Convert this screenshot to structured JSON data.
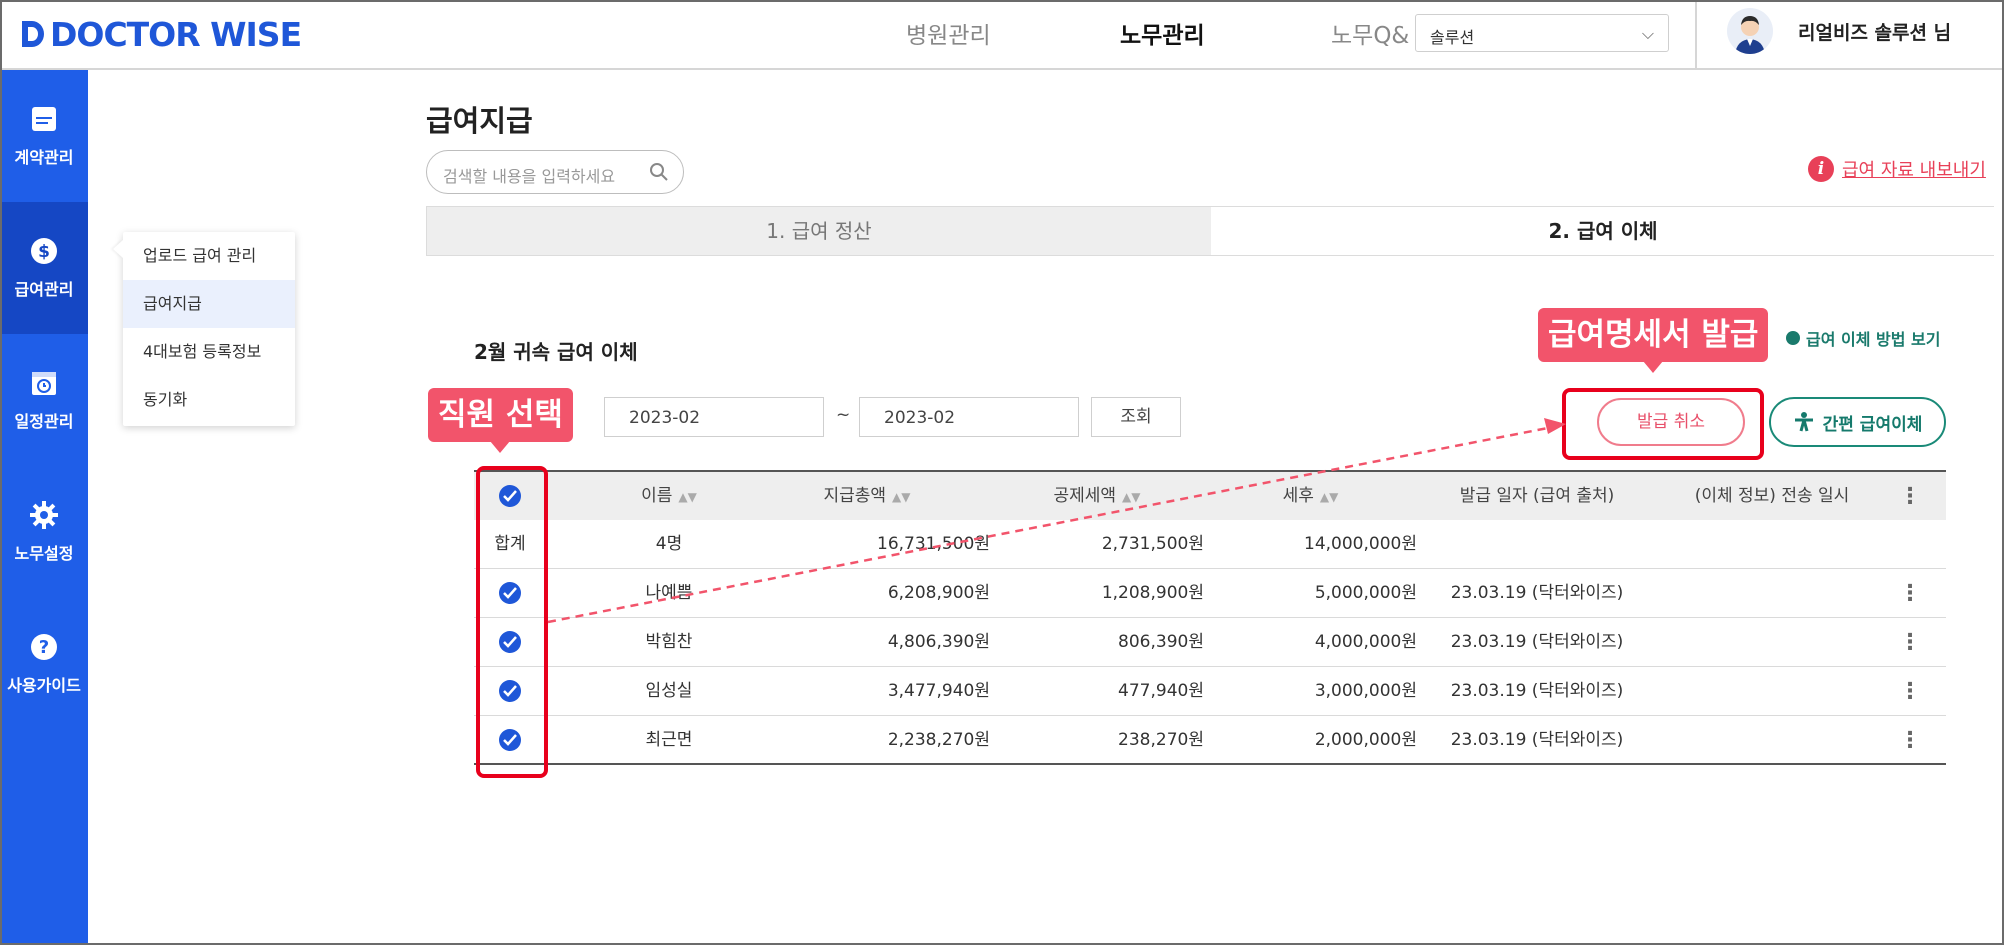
{
  "header": {
    "logo_text": "DOCTOR WISE",
    "nav": [
      "병원관리",
      "노무관리",
      "노무Q&"
    ],
    "org_select_value": "솔루션",
    "user_name": "리얼비즈 솔루션 님"
  },
  "sidebar": {
    "items": [
      {
        "label": "계약관리",
        "icon": "document-icon"
      },
      {
        "label": "급여관리",
        "icon": "dollar-icon"
      },
      {
        "label": "일정관리",
        "icon": "calendar-icon"
      },
      {
        "label": "노무설정",
        "icon": "gear-icon"
      },
      {
        "label": "사용가이드",
        "icon": "question-icon"
      }
    ],
    "active_index": 1
  },
  "submenu": {
    "items": [
      "업로드 급여 관리",
      "급여지급",
      "4대보험 등록정보",
      "동기화"
    ],
    "active_index": 1
  },
  "page": {
    "title": "급여지급",
    "search_placeholder": "검색할 내용을 입력하세요",
    "export_label": "급여 자료 내보내기",
    "tabs": [
      "1. 급여 정산",
      "2. 급여 이체"
    ],
    "active_tab": 1
  },
  "section": {
    "title": "2월 귀속 급여 이체",
    "method_link": "급여 이체 방법 보기",
    "date_from": "2023-02",
    "date_to": "2023-02",
    "tilde": "~",
    "query_button": "조회",
    "cancel_button": "발급 취소",
    "easy_transfer_button": "간편 급여이체"
  },
  "table": {
    "headers": {
      "name": "이름",
      "gross": "지급총액",
      "deduction": "공제세액",
      "net": "세후",
      "issue": "발급 일자 (급여 출처)",
      "sent": "(이체 정보) 전송 일시"
    },
    "total": {
      "label": "합계",
      "count": "4명",
      "gross": "16,731,500원",
      "deduction": "2,731,500원",
      "net": "14,000,000원"
    },
    "rows": [
      {
        "name": "나예쁨",
        "gross": "6,208,900원",
        "deduction": "1,208,900원",
        "net": "5,000,000원",
        "issue": "23.03.19 (닥터와이즈)",
        "sent": ""
      },
      {
        "name": "박힘찬",
        "gross": "4,806,390원",
        "deduction": "806,390원",
        "net": "4,000,000원",
        "issue": "23.03.19 (닥터와이즈)",
        "sent": ""
      },
      {
        "name": "임성실",
        "gross": "3,477,940원",
        "deduction": "477,940원",
        "net": "3,000,000원",
        "issue": "23.03.19 (닥터와이즈)",
        "sent": ""
      },
      {
        "name": "최근면",
        "gross": "2,238,270원",
        "deduction": "238,270원",
        "net": "2,000,000원",
        "issue": "23.03.19 (닥터와이즈)",
        "sent": ""
      }
    ]
  },
  "annotations": {
    "employee_select": "직원 선택",
    "issue_payslip": "급여명세서 발급"
  },
  "colors": {
    "brand_blue": "#1f5ee8",
    "accent_red": "#e84058",
    "teal": "#1a7a6c"
  }
}
